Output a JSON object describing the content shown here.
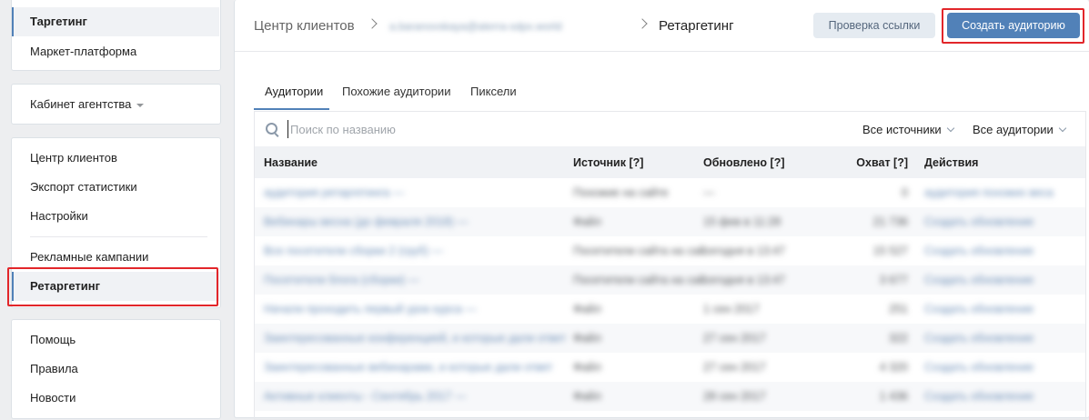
{
  "sidebar": {
    "group1": [
      {
        "label": "Таргетинг",
        "selected": true
      },
      {
        "label": "Маркет-платформа",
        "selected": false
      }
    ],
    "agency_cabinet_label": "Кабинет агентства",
    "group3a": [
      "Центр клиентов",
      "Экспорт статистики",
      "Настройки"
    ],
    "group3b": [
      {
        "label": "Рекламные кампании",
        "selected": false
      },
      {
        "label": "Ретаргетинг",
        "selected": true
      }
    ],
    "group4": [
      "Помощь",
      "Правила",
      "Новости"
    ]
  },
  "header": {
    "crumb_root": "Центр клиентов",
    "crumb_account": "a.baranovskaya@aterra-sdpx.world",
    "crumb_current": "Ретаргетинг",
    "check_link_label": "Проверка ссылки",
    "create_audience_label": "Создать аудиторию"
  },
  "tabs": [
    "Аудитории",
    "Похожие аудитории",
    "Пиксели"
  ],
  "active_tab": 0,
  "search": {
    "placeholder": "Поиск по названию",
    "value": ""
  },
  "filters": {
    "sources": "Все источники",
    "audiences": "Все аудитории"
  },
  "table": {
    "columns": [
      "Название",
      "Источник [?]",
      "Обновлено [?]",
      "Охват [?]",
      "Действия"
    ],
    "rows": [
      [
        "аудитория ретаргетинга —",
        "Похожие на сайте",
        "—",
        "0",
        "аудитория похожих веса"
      ],
      [
        "Вебинары весна (до февраля 2018) —",
        "Файл",
        "15 фев в 11:28",
        "21 736",
        "Создать обновление"
      ],
      [
        "Все посетители сборки 2 (груб) —",
        "Посетители сайта на сай",
        "сегодня в 13:47",
        "15 527",
        "Создать обновление"
      ],
      [
        "Посетители блога (сборки) —",
        "Посетители сайта на сай",
        "сегодня в 13:47",
        "3 677",
        "Создать обновление"
      ],
      [
        "Начали проходить первый урок курса —",
        "Файл",
        "1 сен 2017",
        "251",
        "Создать обновление"
      ],
      [
        "Заинтересованные конференцией, и которые дали ответ",
        "Файл",
        "27 сен 2017",
        "322",
        "Создать обновление"
      ],
      [
        "Заинтересованные вебинарами, и которые дали ответ",
        "Файл",
        "27 сен 2017",
        "4 320",
        "Создать обновление"
      ],
      [
        "Активные клиенты - Сентябрь 2017 —",
        "Файл",
        "28 сен 2017",
        "1 436",
        "Создать обновление"
      ]
    ]
  },
  "colors": {
    "accent": "#5181b8",
    "highlight_box": "#e2262a"
  }
}
